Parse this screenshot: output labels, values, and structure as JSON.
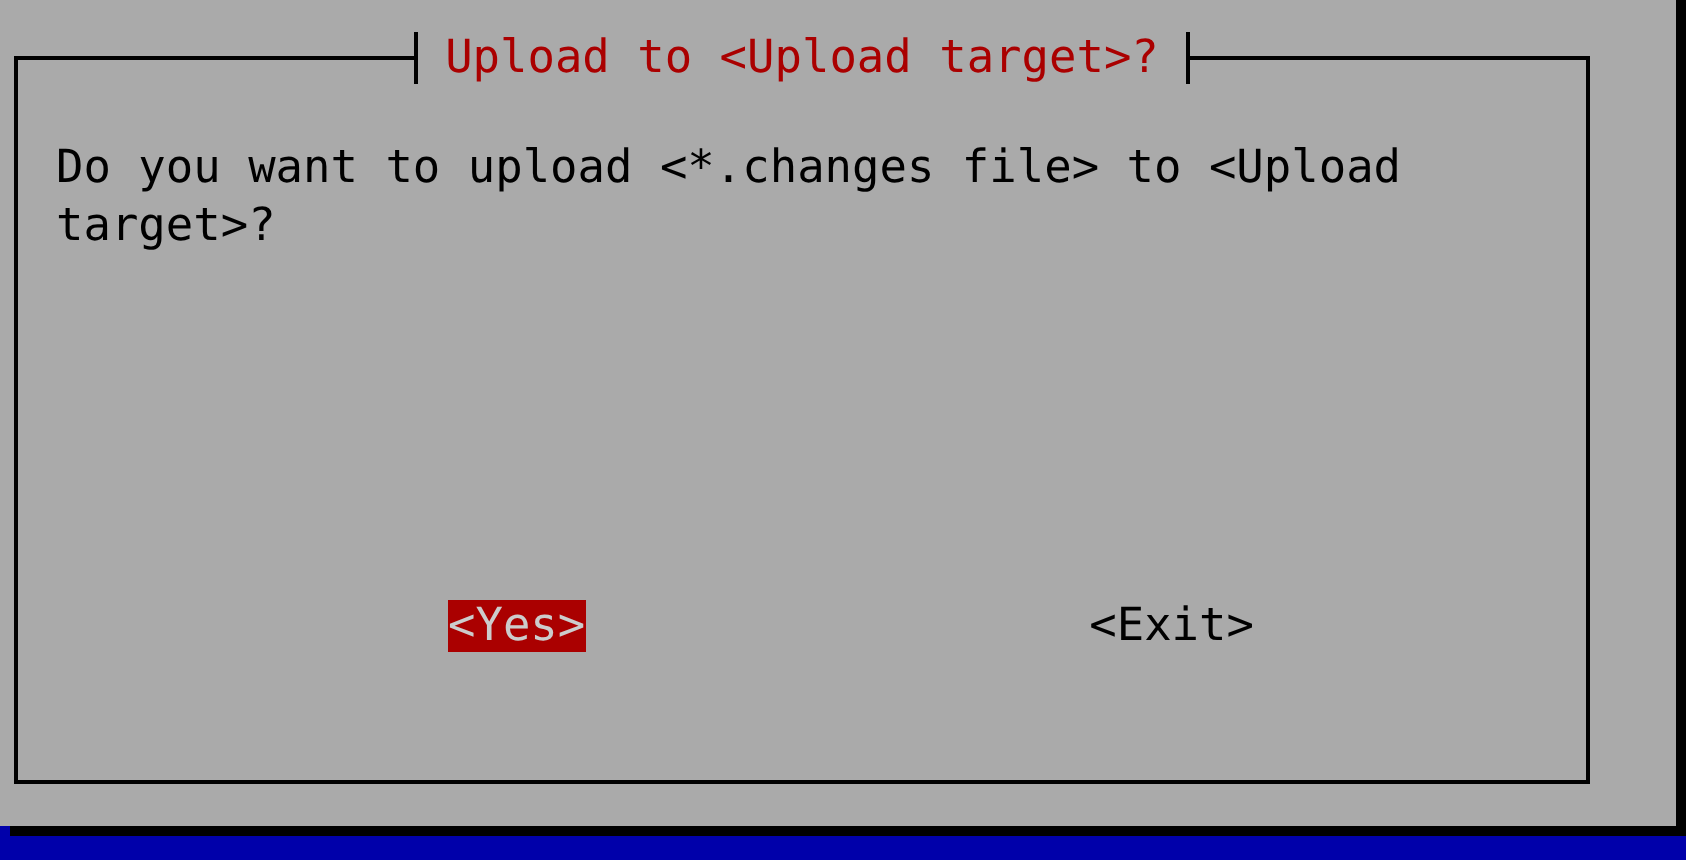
{
  "dialog": {
    "title": "Upload to <Upload target>?",
    "message": "Do you want to upload <*.changes file> to <Upload target>?",
    "buttons": [
      {
        "label": "<Yes>",
        "selected": true
      },
      {
        "label": "<Exit>",
        "selected": false
      }
    ]
  }
}
